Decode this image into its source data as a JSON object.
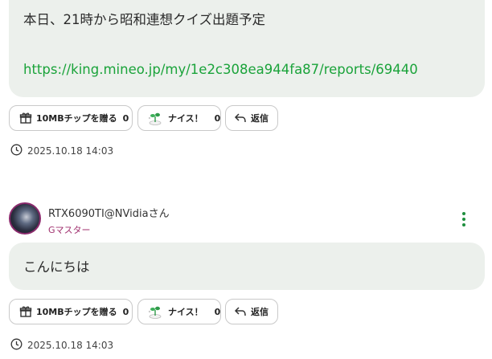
{
  "posts": [
    {
      "body_text": "本日、21時から昭和連想クイズ出題予定",
      "link": "https://king.mineo.jp/my/1e2c308ea944fa87/reports/69440",
      "actions": {
        "gift_label": "10MBチップを贈る",
        "gift_count": "0",
        "nice_label": "ナイス！",
        "nice_count": "0",
        "reply_label": "返信"
      },
      "timestamp": "2025.10.18 14:03"
    },
    {
      "author": "RTX6090TI@NVidiaさん",
      "rank": "Gマスター",
      "body_text": "こんにちは",
      "actions": {
        "gift_label": "10MBチップを贈る",
        "gift_count": "0",
        "nice_label": "ナイス！",
        "nice_count": "0",
        "reply_label": "返信"
      },
      "timestamp": "2025.10.18 14:03"
    }
  ],
  "colors": {
    "link": "#1aa33a",
    "rank": "#a0306e",
    "menu": "#1e8f3e",
    "bubble": "#ecf0ec"
  },
  "icons": {
    "gift": "gift-icon",
    "nice": "nice-plant-icon",
    "reply": "reply-arrow-icon",
    "clock": "clock-icon",
    "menu": "kebab-menu-icon"
  }
}
